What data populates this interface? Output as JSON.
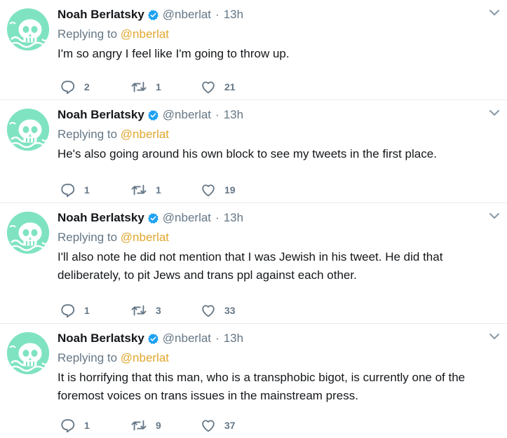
{
  "tweets": [
    {
      "author": "Noah Berlatsky",
      "handle": "@nberlat",
      "separator": "·",
      "time": "13h",
      "replying_prefix": "Replying to",
      "replying_to": "@nberlat",
      "text": "I'm so angry I feel like I'm going to throw up.",
      "replies": "2",
      "retweets": "1",
      "likes": "21"
    },
    {
      "author": "Noah Berlatsky",
      "handle": "@nberlat",
      "separator": "·",
      "time": "13h",
      "replying_prefix": "Replying to",
      "replying_to": "@nberlat",
      "text": "He's also going around his own block to see my tweets in the first place.",
      "replies": "1",
      "retweets": "1",
      "likes": "19"
    },
    {
      "author": "Noah Berlatsky",
      "handle": "@nberlat",
      "separator": "·",
      "time": "13h",
      "replying_prefix": "Replying to",
      "replying_to": "@nberlat",
      "text": "I'll also note he did not mention that I was Jewish in his tweet. He did that deliberately, to pit Jews and trans ppl against each other.",
      "replies": "1",
      "retweets": "3",
      "likes": "33"
    },
    {
      "author": "Noah Berlatsky",
      "handle": "@nberlat",
      "separator": "·",
      "time": "13h",
      "replying_prefix": "Replying to",
      "replying_to": "@nberlat",
      "text": "It is horrifying that this man, who is a transphobic bigot, is currently one of the foremost voices on trans issues in the mainstream press.",
      "replies": "1",
      "retweets": "9",
      "likes": "37"
    }
  ],
  "icons": {
    "verified": "verified-badge-icon",
    "caret": "chevron-down-icon",
    "reply": "reply-icon",
    "retweet": "retweet-icon",
    "like": "heart-icon",
    "avatar": "skull-avatar"
  },
  "colors": {
    "avatar_bg": "#7fe3c2",
    "mention": "#e0a72e",
    "verified": "#1da1f2",
    "muted": "#657786",
    "divider": "#e6ecf0"
  }
}
